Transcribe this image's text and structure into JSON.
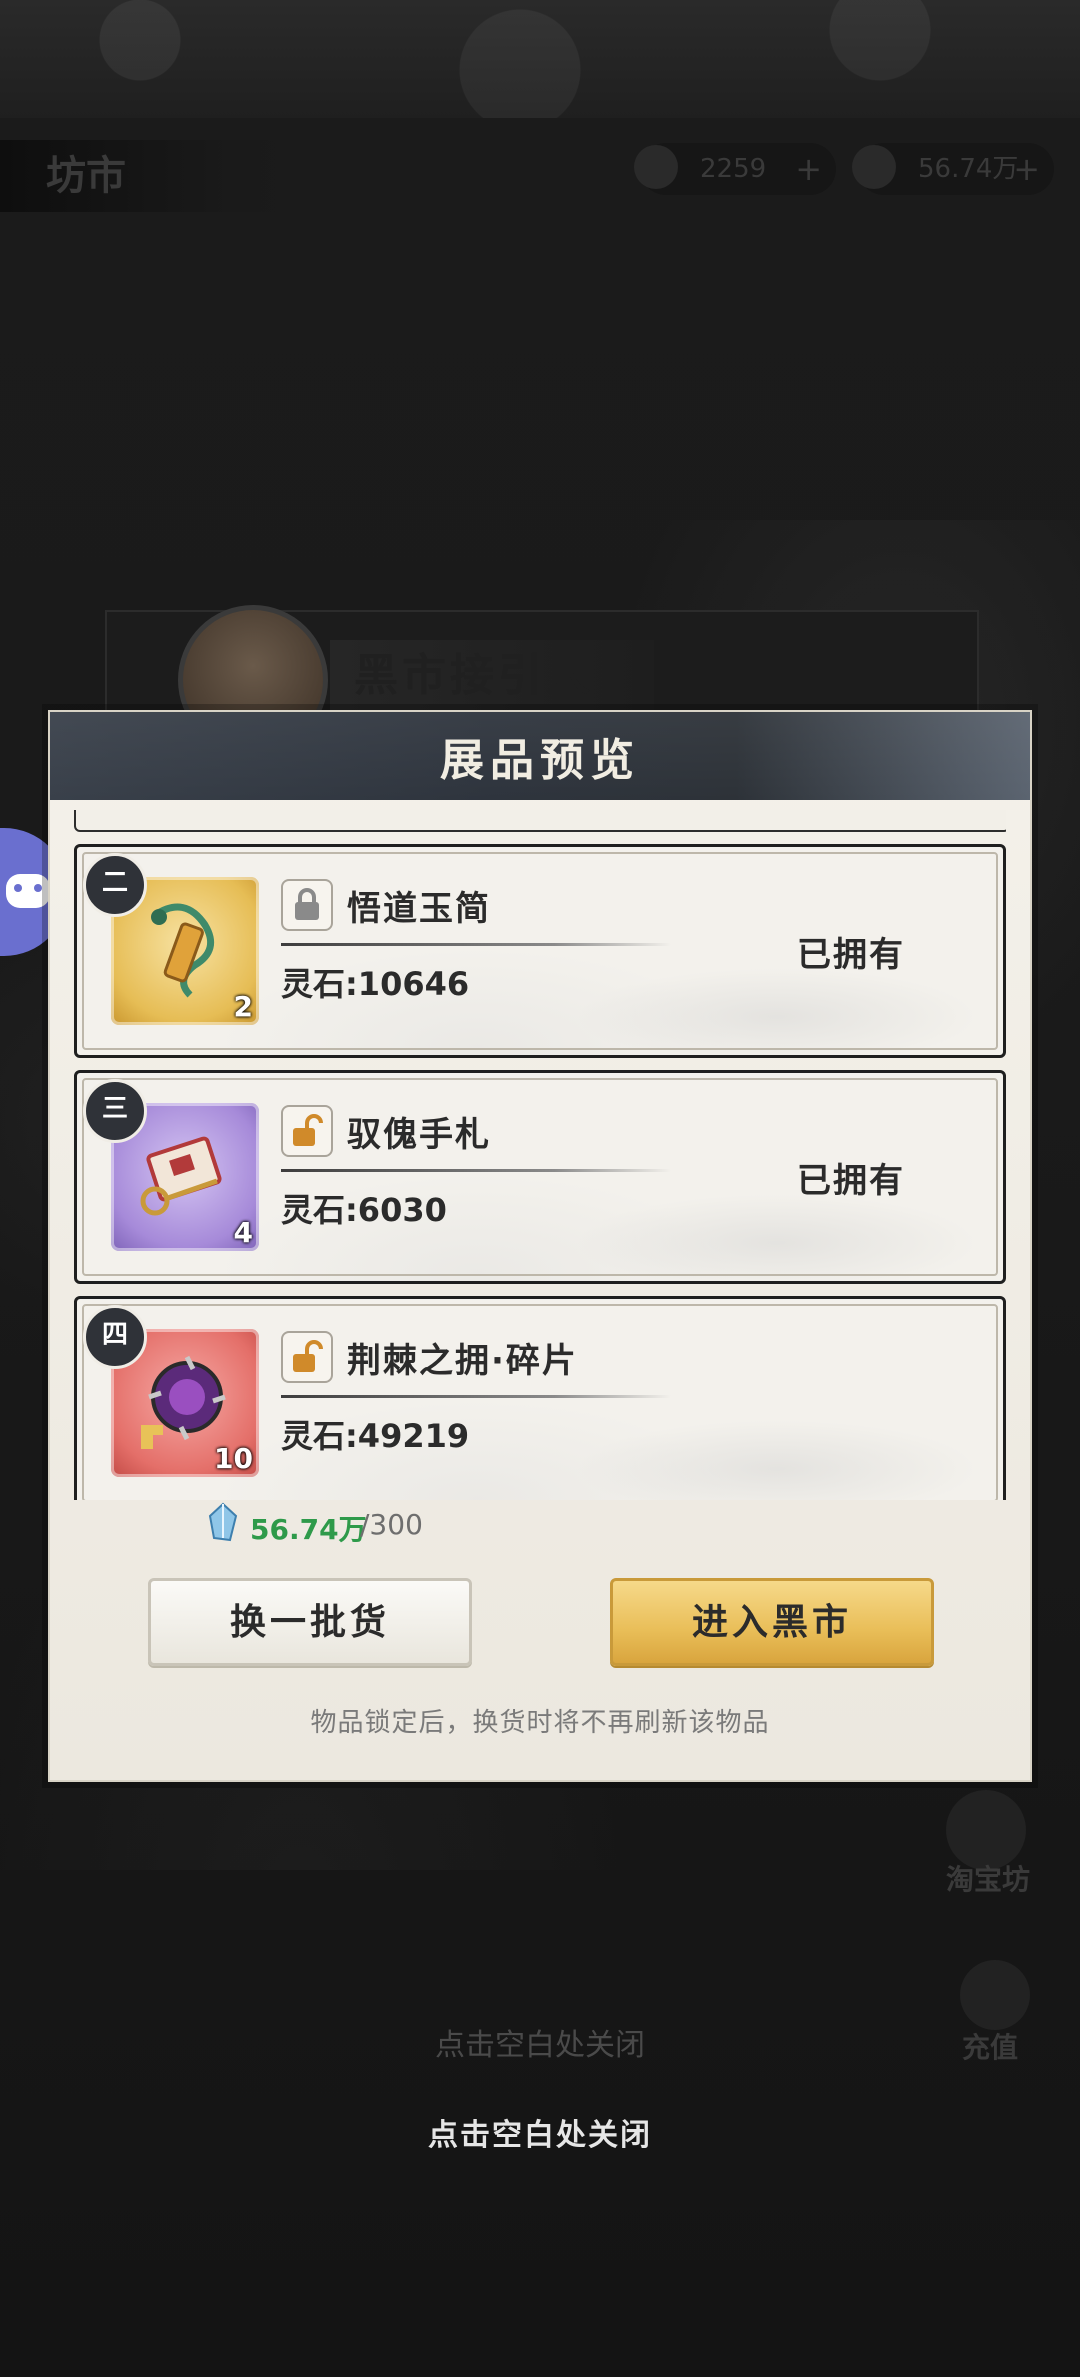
{
  "background": {
    "scene_title": "坊市",
    "resources": [
      {
        "icon": "spirit-stone-icon",
        "value": "2259"
      },
      {
        "icon": "gourd-icon",
        "value": "56.74万"
      }
    ],
    "npc_name": "黑市接引人",
    "side_buttons": [
      "淘宝坊",
      "充值"
    ],
    "close_hint_faded": "点击空白处关闭"
  },
  "modal": {
    "title": "展品预览",
    "items": [
      {
        "rank": "二",
        "name": "悟道玉简",
        "qty": "2",
        "price": "灵石:10646",
        "status": "已拥有",
        "locked": true,
        "color": "gold"
      },
      {
        "rank": "三",
        "name": "驭傀手札",
        "qty": "4",
        "price": "灵石:6030",
        "status": "已拥有",
        "locked": false,
        "color": "purple"
      },
      {
        "rank": "四",
        "name": "荆棘之拥·碎片",
        "qty": "10",
        "price": "灵石:49219",
        "status": "",
        "locked": false,
        "color": "red"
      }
    ],
    "currency": {
      "have": "56.74万",
      "need": "/300",
      "have_color": "#2e9a4a"
    },
    "swap_button": "换一批货",
    "enter_button": "进入黑市",
    "note": "物品锁定后，换货时将不再刷新该物品"
  },
  "close_hint": "点击空白处关闭",
  "colors": {
    "accent_gold": "#e9be58",
    "header_dark": "#2e343d"
  }
}
